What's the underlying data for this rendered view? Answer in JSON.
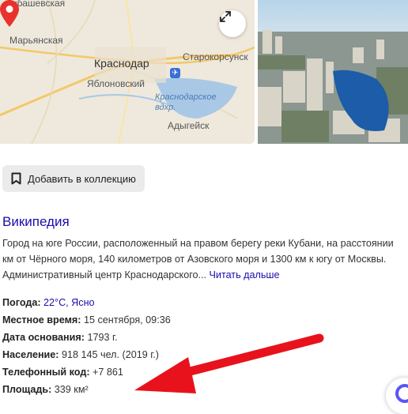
{
  "map": {
    "labels": {
      "city1": "Марьянская",
      "city2": "Краснодар",
      "city3": "Яблоновский",
      "city4": "Старокорсунск",
      "city5": "Адыгейск",
      "water_line1": "Краснодарское",
      "water_line2": "вдхр.",
      "top_cut": "шбашевская"
    },
    "expand_icon": "expand-icon",
    "pin_color": "#e8322b"
  },
  "photo": {
    "alt_icon": "city-photo"
  },
  "collection": {
    "label": "Добавить в коллекцию",
    "icon": "bookmark-icon"
  },
  "wiki": {
    "title": "Википедия",
    "description": "Город на юге России, расположенный на правом берегу реки Кубани, на расстоянии км от Чёрного моря, 140 километров от Азовского моря и 1300 км к югу от Москвы. Административный центр Краснодарского...",
    "read_more": "Читать дальше"
  },
  "facts": {
    "weather_label": "Погода:",
    "weather_value": "22°С, Ясно",
    "time_label": "Местное время:",
    "time_value": "15 сентября, 09:36",
    "founded_label": "Дата основания:",
    "founded_value": "1793 г.",
    "population_label": "Население:",
    "population_value": "918 145 чел. (2019 г.)",
    "phone_label": "Телефонный код:",
    "phone_value": "+7 861",
    "area_label": "Площадь:",
    "area_value": "339 км²"
  },
  "colors": {
    "link": "#1a0dab",
    "arrow": "#e8121c",
    "alice": "#5a55f5"
  }
}
